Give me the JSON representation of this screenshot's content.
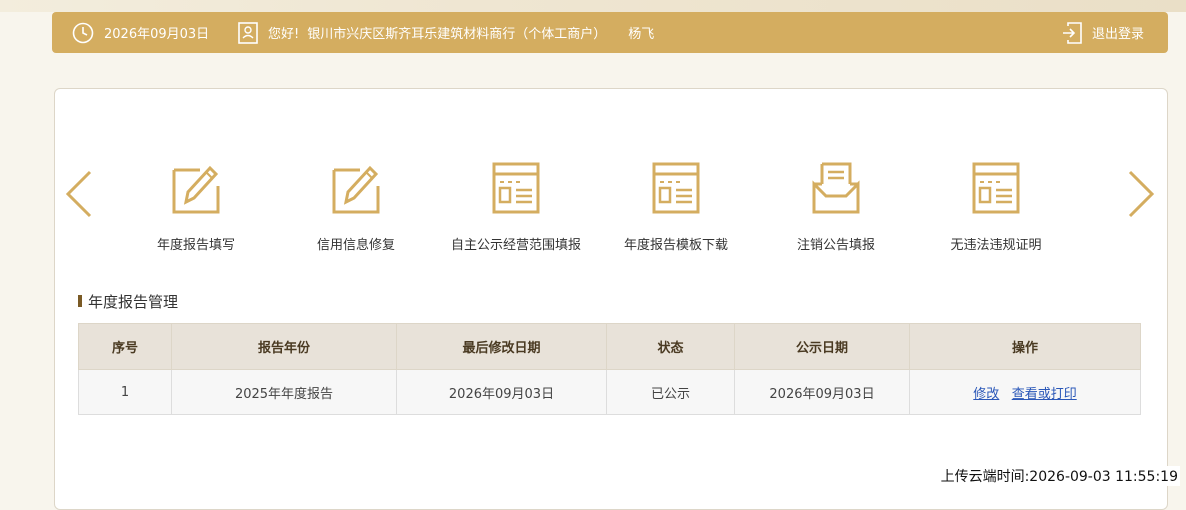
{
  "header": {
    "date": "2026年09月03日",
    "greeting": "您好!",
    "company": "银川市兴庆区斯齐耳乐建筑材料商行（个体工商户）",
    "user": "杨飞",
    "logout_label": "退出登录",
    "icons": [
      "clock-icon",
      "user-card-icon",
      "logout-icon"
    ]
  },
  "carousel": {
    "items": [
      {
        "label": "年度报告填写",
        "icon": "edit-icon"
      },
      {
        "label": "信用信息修复",
        "icon": "edit-icon"
      },
      {
        "label": "自主公示经营范围填报",
        "icon": "form-icon"
      },
      {
        "label": "年度报告模板下载",
        "icon": "form-icon"
      },
      {
        "label": "注销公告填报",
        "icon": "inbox-icon"
      },
      {
        "label": "无违法违规证明",
        "icon": "form-icon"
      }
    ]
  },
  "section": {
    "title": "年度报告管理"
  },
  "table": {
    "headers": [
      "序号",
      "报告年份",
      "最后修改日期",
      "状态",
      "公示日期",
      "操作"
    ],
    "rows": [
      {
        "index": "1",
        "year": "2025年年度报告",
        "modified": "2026年09月03日",
        "status": "已公示",
        "publish_date": "2026年09月03日",
        "actions": [
          "修改",
          "查看或打印"
        ]
      }
    ]
  },
  "footer": {
    "upload_time": "上传云端时间:2026-09-03 11:55:19"
  },
  "colors": {
    "accent": "#d4ad60",
    "header_text": "#ffffff",
    "link": "#2a57b8"
  }
}
